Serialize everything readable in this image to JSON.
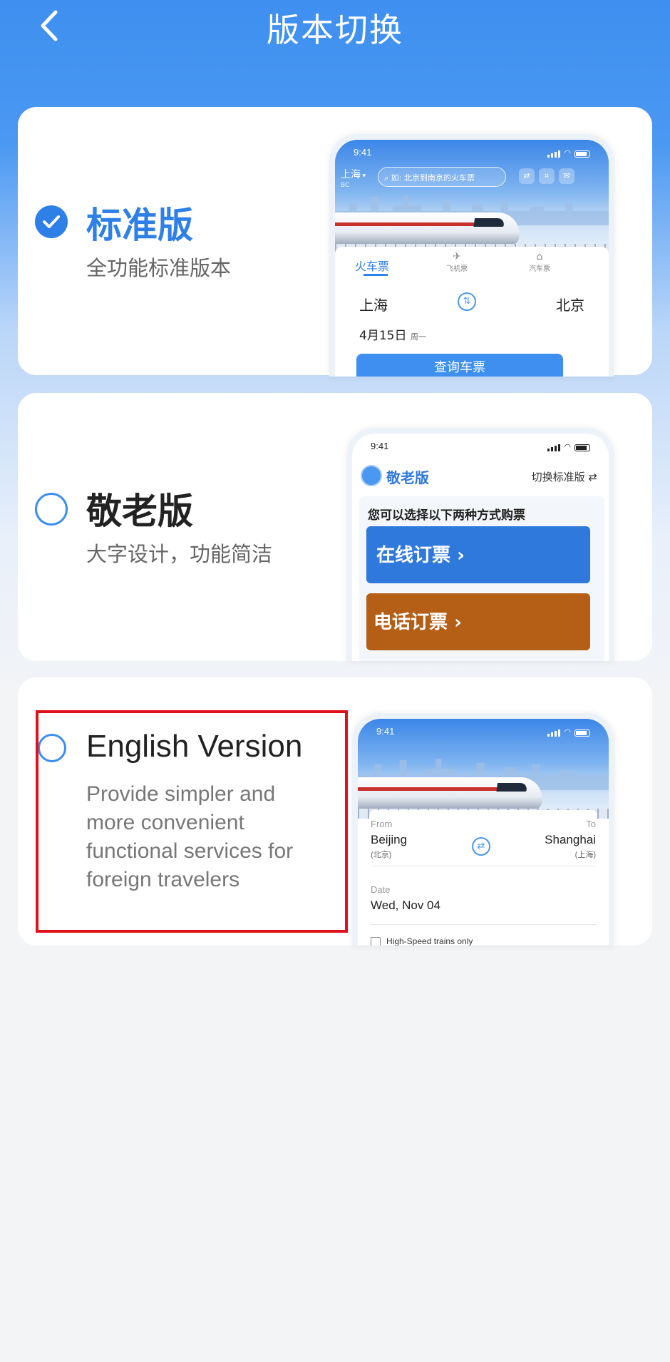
{
  "header": {
    "title": "版本切换"
  },
  "options": [
    {
      "title": "标准版",
      "desc": "全功能标准版本",
      "selected": true
    },
    {
      "title": "敬老版",
      "desc": "大字设计，功能简洁",
      "selected": false
    },
    {
      "title": "English Version",
      "desc": "Provide simpler and more convenient functional services for foreign travelers",
      "selected": false
    }
  ],
  "mock_standard": {
    "time": "9:41",
    "city": "上海",
    "city_sub": "BC",
    "search_placeholder": "如: 北京到南京的火车票",
    "tabs": [
      "火车票",
      "飞机票",
      "汽车票"
    ],
    "from": "上海",
    "to": "北京",
    "date": "4月15日",
    "weekday": "周一",
    "search_btn": "查询车票"
  },
  "mock_elder": {
    "time": "9:41",
    "brand": "敬老版",
    "switch_label": "切换标准版",
    "prompt": "您可以选择以下两种方式购票",
    "online_btn": "在线订票",
    "phone_btn": "电话订票"
  },
  "mock_english": {
    "time": "9:41",
    "from_label": "From",
    "to_label": "To",
    "from_city": "Beijing",
    "from_city_cn": "(北京)",
    "to_city": "Shanghai",
    "to_city_cn": "(上海)",
    "date_label": "Date",
    "date_value": "Wed, Nov 04",
    "checkbox_label": "High-Speed trains only"
  },
  "colors": {
    "accent": "#2f7fe8",
    "highlight": "#e0101a",
    "online": "#2f79dc",
    "phone": "#b45e16"
  }
}
